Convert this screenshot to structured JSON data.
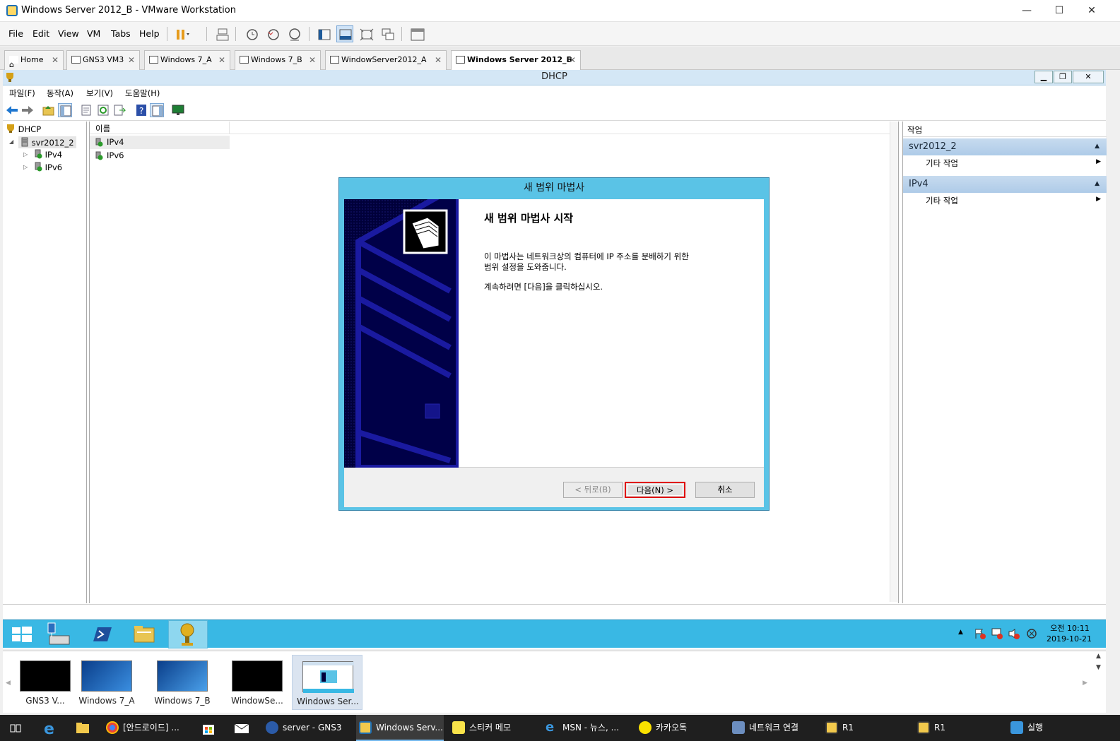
{
  "vmware": {
    "title": "Windows Server 2012_B - VMware Workstation",
    "menu": [
      {
        "label": "File",
        "key": "F"
      },
      {
        "label": "Edit",
        "key": "E"
      },
      {
        "label": "View",
        "key": "V"
      },
      {
        "label": "VM",
        "key": "M"
      },
      {
        "label": "Tabs",
        "key": "T"
      },
      {
        "label": "Help",
        "key": "H"
      }
    ],
    "tabs": [
      {
        "label": "Home"
      },
      {
        "label": "GNS3 VM3"
      },
      {
        "label": "Windows 7_A"
      },
      {
        "label": "Windows 7_B"
      },
      {
        "label": "WindowServer2012_A"
      },
      {
        "label": "Windows Server 2012_B"
      }
    ],
    "close_glyph": "✕"
  },
  "mmc": {
    "title": "DHCP",
    "menu": [
      "파일(F)",
      "동작(A)",
      "보기(V)",
      "도움말(H)"
    ],
    "tree": {
      "root": "DHCP",
      "server": "svr2012_2",
      "children": [
        "IPv4",
        "IPv6"
      ]
    },
    "list": {
      "column": "이름",
      "rows": [
        "IPv4",
        "IPv6"
      ]
    },
    "actions": {
      "header": "작업",
      "sections": [
        {
          "title": "svr2012_2",
          "item": "기타 작업"
        },
        {
          "title": "IPv4",
          "item": "기타 작업"
        }
      ]
    }
  },
  "wizard": {
    "window_title": "새 범위 마법사",
    "heading": "새 범위 마법사 시작",
    "para1_line1": "이 마법사는 네트워크상의 컴퓨터에 IP 주소를 분배하기 위한",
    "para1_line2": "범위 설정을 도와줍니다.",
    "para2": "계속하려면 [다음]을 클릭하십시오.",
    "back_button": "< 뒤로(B)",
    "next_button": "다음(N) >",
    "cancel_button": "취소"
  },
  "guest_taskbar": {
    "clock_time": "오전 10:11",
    "clock_date": "2019-10-21"
  },
  "thumbnails": [
    {
      "label": "GNS3 V..."
    },
    {
      "label": "Windows 7_A"
    },
    {
      "label": "Windows 7_B"
    },
    {
      "label": "WindowSe..."
    },
    {
      "label": "Windows Ser..."
    }
  ],
  "host_taskbar": {
    "items": [
      {
        "label": "[안드로이드] ..."
      },
      {
        "label": "server - GNS3"
      },
      {
        "label": "Windows Serv..."
      },
      {
        "label": "스티커 메모"
      },
      {
        "label": "MSN - 뉴스, ..."
      },
      {
        "label": "카카오톡"
      },
      {
        "label": "네트워크 연결"
      },
      {
        "label": "R1"
      },
      {
        "label": "R1"
      },
      {
        "label": "실행"
      }
    ]
  }
}
